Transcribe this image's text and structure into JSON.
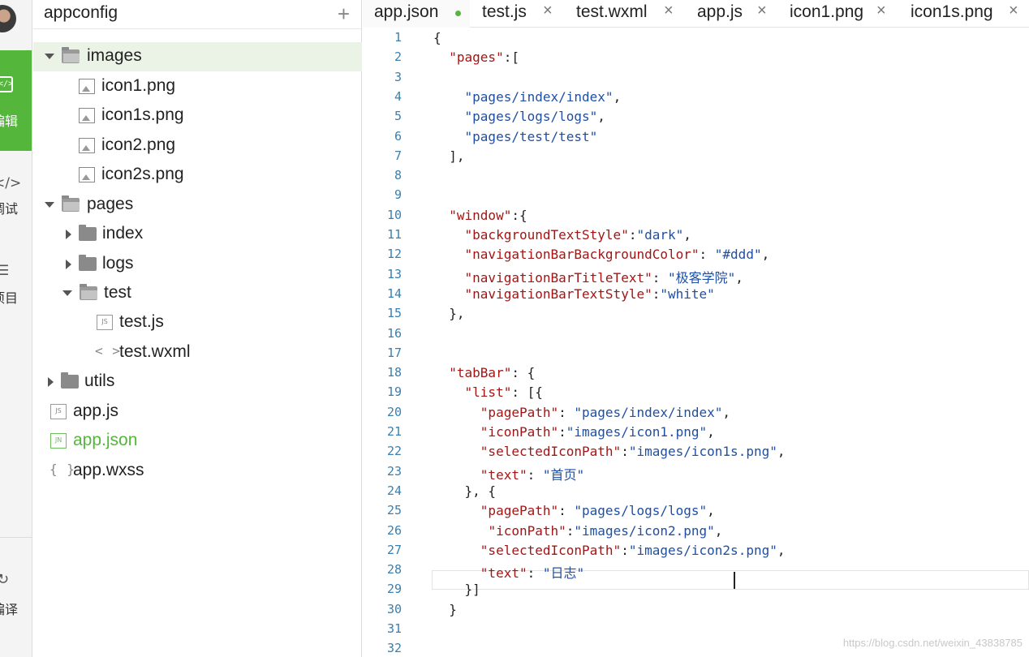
{
  "activity_bar": {
    "edit_icon_text": "</>",
    "edit_label": "编辑",
    "debug_icon_text": "</>",
    "debug_label": "调试",
    "project_icon_text": "☰",
    "project_label": "项目",
    "compile_label": "编译",
    "active_color": "#55b63c"
  },
  "explorer": {
    "title": "appconfig",
    "add_label": "+",
    "items": [
      {
        "label": "images",
        "kind": "folder-open"
      },
      {
        "label": "icon1.png",
        "kind": "image"
      },
      {
        "label": "icon1s.png",
        "kind": "image"
      },
      {
        "label": "icon2.png",
        "kind": "image"
      },
      {
        "label": "icon2s.png",
        "kind": "image"
      },
      {
        "label": "pages",
        "kind": "folder-open"
      },
      {
        "label": "index",
        "kind": "folder"
      },
      {
        "label": "logs",
        "kind": "folder"
      },
      {
        "label": "test",
        "kind": "folder-open"
      },
      {
        "label": "test.js",
        "kind": "js",
        "tag": "JS"
      },
      {
        "label": "test.wxml",
        "kind": "wxml",
        "tag": "< >"
      },
      {
        "label": "utils",
        "kind": "folder"
      },
      {
        "label": "app.js",
        "kind": "js",
        "tag": "JS"
      },
      {
        "label": "app.json",
        "kind": "json",
        "tag": "JN"
      },
      {
        "label": "app.wxss",
        "kind": "wxss",
        "tag": "{ }"
      }
    ]
  },
  "tabs": [
    {
      "label": "app.json",
      "close": "•"
    },
    {
      "label": "test.js",
      "close": "×"
    },
    {
      "label": "test.wxml",
      "close": "×"
    },
    {
      "label": "app.js",
      "close": "×"
    },
    {
      "label": "icon1.png",
      "close": "×"
    },
    {
      "label": "icon1s.png",
      "close": "×"
    }
  ],
  "code_lines": [
    "{",
    "  \"pages\":[",
    "",
    "    \"pages/index/index\",",
    "    \"pages/logs/logs\",",
    "    \"pages/test/test\"",
    "  ],",
    "",
    "",
    "  \"window\":{",
    "    \"backgroundTextStyle\":\"dark\",",
    "    \"navigationBarBackgroundColor\": \"#ddd\",",
    "    \"navigationBarTitleText\": \"极客学院\",",
    "    \"navigationBarTextStyle\":\"white\"",
    "  },",
    "",
    "",
    "  \"tabBar\": {",
    "    \"list\": [{",
    "      \"pagePath\": \"pages/index/index\",",
    "      \"iconPath\":\"images/icon1.png\",",
    "      \"selectedIconPath\":\"images/icon1s.png\",",
    "      \"text\": \"首页\"",
    "    }, {",
    "      \"pagePath\": \"pages/logs/logs\",",
    "       \"iconPath\":\"images/icon2.png\",",
    "      \"selectedIconPath\":\"images/icon2s.png\",",
    "      \"text\": \"日志\"",
    "    }]",
    "  }",
    "",
    ""
  ],
  "colors": {
    "key": "#a31515",
    "string": "#1f4fa3",
    "line_number": "#3a7fae",
    "accent": "#55b63c"
  },
  "watermark": "https://blog.csdn.net/weixin_43838785"
}
